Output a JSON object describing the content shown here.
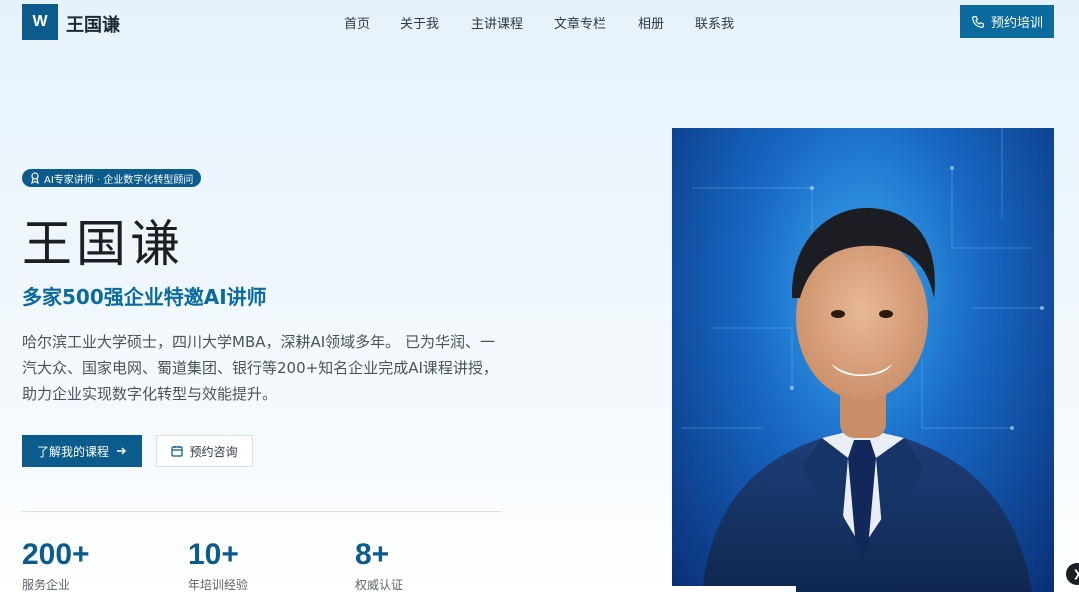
{
  "brand": {
    "logo_letter": "W",
    "name": "王国谦"
  },
  "nav": {
    "items": [
      {
        "label": "首页"
      },
      {
        "label": "关于我"
      },
      {
        "label": "主讲课程"
      },
      {
        "label": "文章专栏"
      },
      {
        "label": "相册"
      },
      {
        "label": "联系我"
      }
    ],
    "cta_label": "预约培训"
  },
  "hero": {
    "badge": "AI专家讲师 · 企业数字化转型顾问",
    "name": "王国谦",
    "subtitle": "多家500强企业特邀AI讲师",
    "description": "哈尔滨工业大学硕士，四川大学MBA，深耕AI领域多年。 已为华润、一汽大众、国家电网、蜀道集团、银行等200+知名企业完成AI课程讲授， 助力企业实现数字化转型与效能提升。",
    "primary_button": "了解我的课程",
    "secondary_button": "预约咨询"
  },
  "stats": [
    {
      "value": "200+",
      "label": "服务企业"
    },
    {
      "value": "10+",
      "label": "年培训经验"
    },
    {
      "value": "8+",
      "label": "权威认证"
    }
  ],
  "colors": {
    "primary": "#0b5b8c",
    "accent": "#0b6a9e",
    "background": "#e6f2fb"
  },
  "icons": {
    "cta": "phone-icon",
    "badge": "award-icon",
    "primary_button": "arrow-right-icon",
    "secondary_button": "calendar-icon",
    "scroll": "chevron-right-icon"
  }
}
